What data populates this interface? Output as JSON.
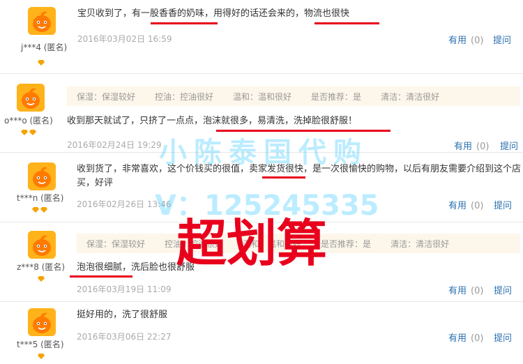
{
  "colors": {
    "link": "#2a6fb0",
    "highlight": "#e8001c",
    "watermark": "#3cc8ff"
  },
  "reviews": [
    {
      "user": "j***4 (匿名)",
      "gems": 1,
      "text": "宝贝收到了，有一股香香的奶味，用得好的话还会来的，物流也很快",
      "date": "2016年03月02日 16:59",
      "useful": "有用",
      "count": "(0)",
      "ask": "提问"
    },
    {
      "user": "o***o (匿名)",
      "gems": 2,
      "tags": [
        "保湿：保湿较好",
        "控油：控油很好",
        "温和：温和很好",
        "是否推荐：是",
        "清洁：清洁很好"
      ],
      "text": "收到那天就试了，只挤了一点点，泡沫就很多，易清洗，洗掉脸很舒服！",
      "date": "2016年02月24日 19:29",
      "useful": "有用",
      "count": "(0)",
      "ask": "提问"
    },
    {
      "user": "t***n (匿名)",
      "gems": 2,
      "text": "收到货了，非常喜欢，这个价钱买的很值，卖家发货很快，是一次很愉快的购物，以后有朋友需要介绍到这个店买，好评",
      "date": "2016年02月26日 13:46",
      "useful": "有用",
      "count": "(0)",
      "ask": "提问"
    },
    {
      "user": "z***8 (匿名)",
      "gems": 1,
      "tags": [
        "保湿：保湿较好",
        "控油：控油很好",
        "温和：温和很好",
        "是否推荐：是",
        "清洁：清洁很好"
      ],
      "text": "泡泡很细腻，洗后脸也很舒服",
      "date": "2016年03月19日 11:09",
      "useful": "有用",
      "count": "(0)",
      "ask": "提问"
    },
    {
      "user": "t***5 (匿名)",
      "gems": 1,
      "text": "挺好用的，洗了很舒服",
      "date": "2016年03月06日 22:27",
      "useful": "有用",
      "count": "(0)",
      "ask": "提问"
    }
  ],
  "watermark": {
    "shop": "小陈泰国代购",
    "contact": "V：125245335",
    "slogan": "超划算"
  }
}
